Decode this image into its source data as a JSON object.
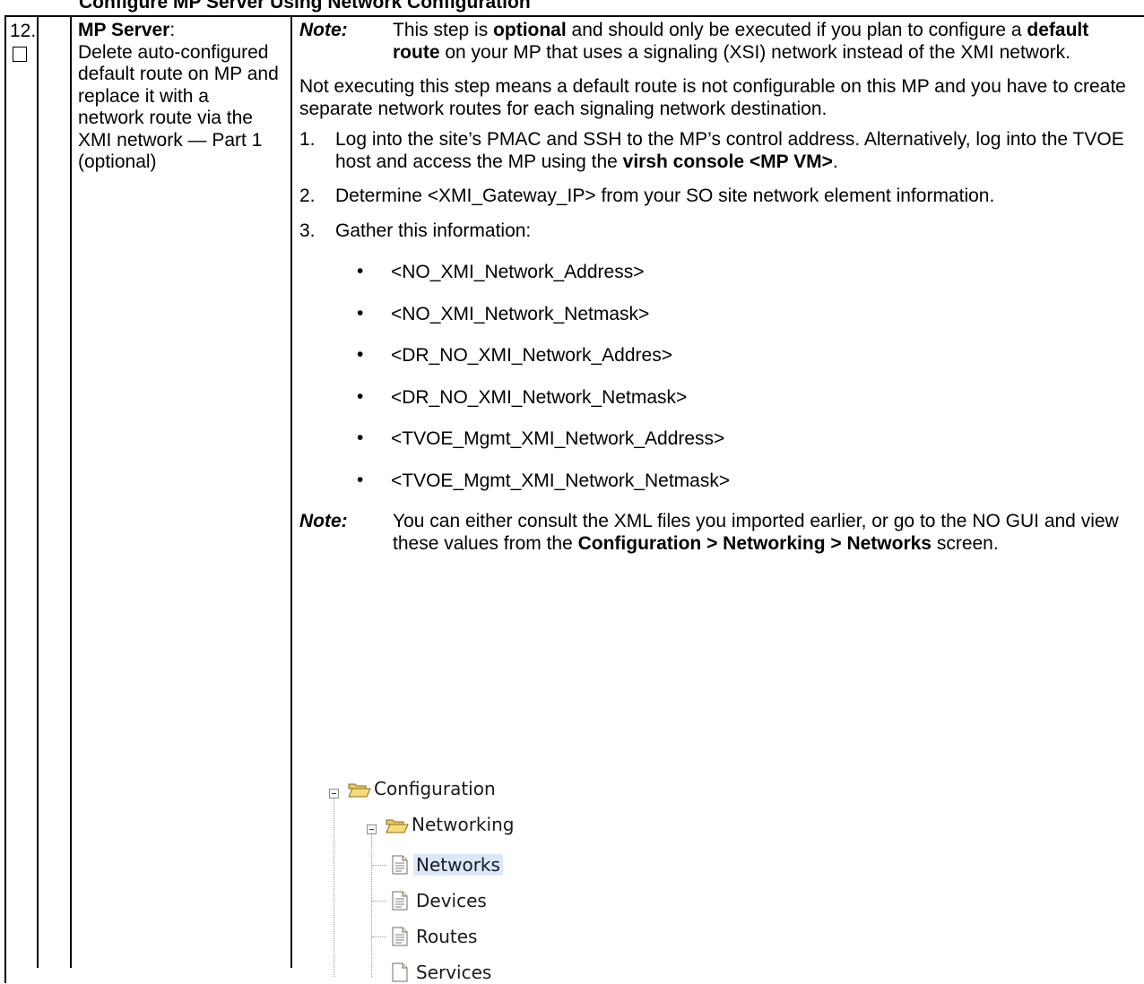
{
  "header_partial": "Configure MP Server Using Network Configuration",
  "step": {
    "number": "12.",
    "title_bold": "MP Server",
    "title_rest": ":",
    "title_body": "Delete auto-configured default route on MP and replace it with a network route via the XMI network — Part 1 (optional)"
  },
  "note1": {
    "label": "Note:",
    "t1": "This step is ",
    "b1": "optional",
    "t2": " and should only be executed if you plan to configure a ",
    "b2": "default route",
    "t3": " on your MP that uses a signaling (XSI) network instead of the XMI network."
  },
  "para1": "Not executing this step means a default route is not configurable on this MP and you have to create separate network routes for each signaling network destination.",
  "items": [
    {
      "num": "1.",
      "t1": "Log into the site’s PMAC and SSH to the MP’s control address. Alternatively, log into the TVOE host and access the MP using the ",
      "b1": "virsh console <MP VM>",
      "t2": "."
    },
    {
      "num": "2.",
      "t1": "Determine <XMI_Gateway_IP> from your SO site network element information."
    },
    {
      "num": "3.",
      "t1": "Gather this information:"
    }
  ],
  "bullets": [
    "<NO_XMI_Network_Address>",
    "<NO_XMI_Network_Netmask>",
    "<DR_NO_XMI_Network_Addres>",
    "<DR_NO_XMI_Network_Netmask>",
    "<TVOE_Mgmt_XMI_Network_Address>",
    "<TVOE_Mgmt_XMI_Network_Netmask>"
  ],
  "bullet_glyph": "•",
  "note2": {
    "label": "Note:",
    "t1": "You can either consult the XML files you imported earlier, or go to the NO GUI and view these values from the ",
    "b1": "Configuration > Networking > Networks",
    "t2": " screen."
  },
  "tree": {
    "root": "Configuration",
    "child": "Networking",
    "leaves": [
      "Networks",
      "Devices",
      "Routes",
      "Services"
    ]
  },
  "icons": {
    "expander": "collapse-icon",
    "folder": "folder-open-icon",
    "page": "page-icon"
  },
  "colors": {
    "folder": "#e9c95a",
    "selection": "#dbe8fb"
  }
}
